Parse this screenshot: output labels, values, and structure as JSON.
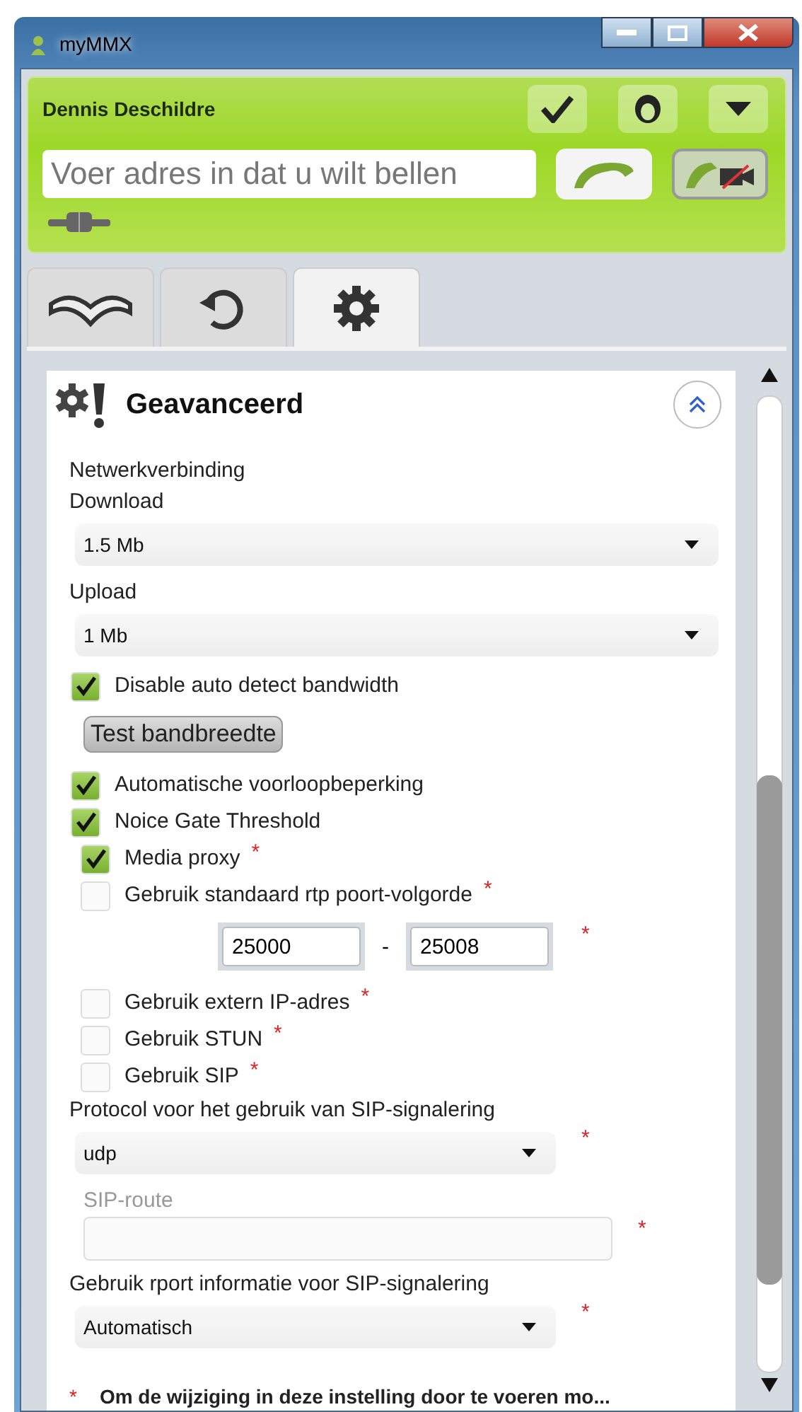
{
  "window": {
    "title": "myMMX"
  },
  "user": {
    "name": "Dennis Deschildre"
  },
  "address": {
    "placeholder": "Voer adres in dat u wilt bellen"
  },
  "tabs": [
    {
      "kind": "book",
      "selected": false
    },
    {
      "kind": "history",
      "selected": false
    },
    {
      "kind": "settings",
      "selected": true
    }
  ],
  "section": {
    "title": "Geavanceerd",
    "expanded": true
  },
  "fields": [
    {
      "kind": "heading",
      "text": "Netwerkverbinding"
    },
    {
      "kind": "select",
      "label": "Download",
      "value": "1.5 Mb"
    },
    {
      "kind": "select",
      "label": "Upload",
      "value": "1 Mb"
    },
    {
      "kind": "checkbox",
      "label": "Disable auto detect bandwidth",
      "checked": true
    },
    {
      "kind": "button",
      "label": "Test bandbreedte"
    },
    {
      "kind": "checkbox",
      "label": "Automatische voorloopbeperking",
      "checked": true
    },
    {
      "kind": "checkbox",
      "label": "Noice Gate Threshold",
      "checked": true
    },
    {
      "kind": "checkbox",
      "label": "Media proxy",
      "checked": true,
      "required_mark": "*"
    },
    {
      "kind": "checkbox",
      "label": "Gebruik standaard rtp poort-volgorde",
      "checked": false,
      "required_mark": "*"
    },
    {
      "kind": "range",
      "from": "25000",
      "separator": "-",
      "to": "25008",
      "required_mark": "*"
    },
    {
      "kind": "checkbox",
      "label": "Gebruik extern IP-adres",
      "checked": false,
      "required_mark": "*"
    },
    {
      "kind": "checkbox",
      "label": "Gebruik STUN",
      "checked": false,
      "required_mark": "*"
    },
    {
      "kind": "checkbox",
      "label": "Gebruik SIP",
      "checked": false,
      "required_mark": "*"
    },
    {
      "kind": "select",
      "label": "Protocol voor het gebruik van SIP-signalering",
      "value": "udp",
      "required_mark": "*"
    },
    {
      "kind": "text",
      "label": "SIP-route",
      "disabled": true,
      "required_mark": "*"
    },
    {
      "kind": "select",
      "label": "Gebruik rport informatie voor SIP-signalering",
      "value": "Automatisch",
      "required_mark": "*"
    }
  ],
  "footnote": {
    "mark": "*",
    "text": "Om de wijziging in deze instelling door te voeren mo..."
  }
}
